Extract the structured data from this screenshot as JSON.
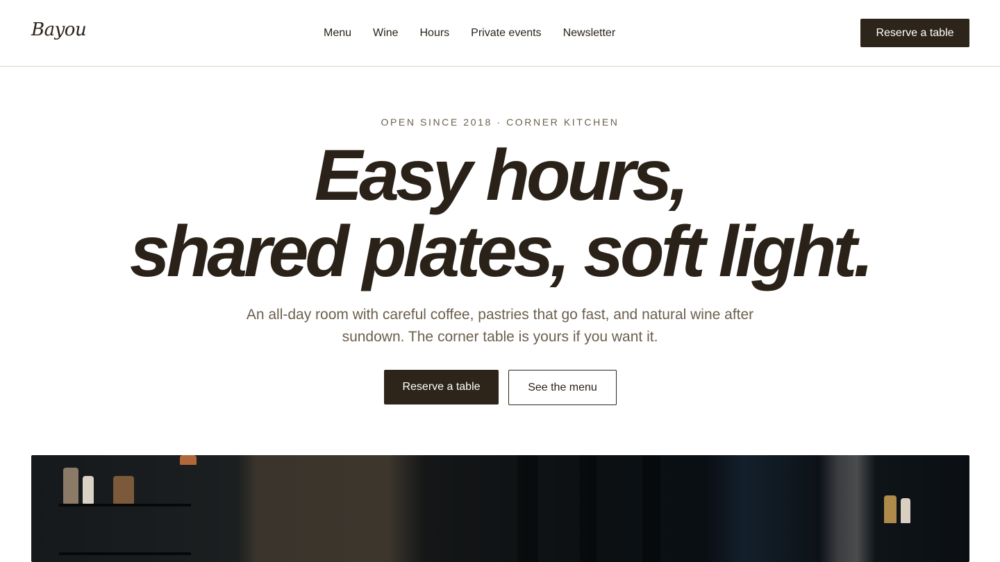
{
  "header": {
    "logo": "Bayou",
    "nav": [
      "Menu",
      "Wine",
      "Hours",
      "Private events",
      "Newsletter"
    ],
    "cta_label": "Reserve a table"
  },
  "hero": {
    "eyebrow": "OPEN SINCE 2018 · CORNER KITCHEN",
    "headline_line1": "Easy hours,",
    "headline_line2": "shared plates, soft light.",
    "subcopy": "An all-day room with careful coffee, pastries that go fast, and natural wine after sundown. The corner table is yours if you want it.",
    "primary_cta": "Reserve a table",
    "secondary_cta": "See the menu"
  },
  "colors": {
    "ink": "#2a2218",
    "button_dark": "#2d251a",
    "muted": "#6b5f4d",
    "divider": "#d9d3c4",
    "background": "#ffffff"
  }
}
